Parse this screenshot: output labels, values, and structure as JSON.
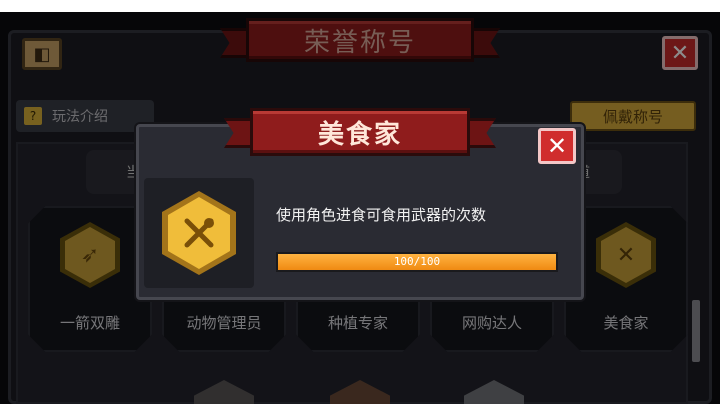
{
  "screen": {
    "title": "荣誉称号",
    "how_to_play": "玩法介绍",
    "how_to_icon": "?",
    "wear_title": "佩戴称号",
    "back_icon": "exit-icon",
    "close_icon": "close-icon",
    "category_left_fragment": "当",
    "category_right_fragment": "道",
    "titles": [
      {
        "label": "一箭双雕",
        "icon": "arrow-badge-icon"
      },
      {
        "label": "动物管理员",
        "icon": "animal-badge-icon"
      },
      {
        "label": "种植专家",
        "icon": "plant-badge-icon"
      },
      {
        "label": "网购达人",
        "icon": "shopping-badge-icon"
      },
      {
        "label": "美食家",
        "icon": "fork-spoon-badge-icon"
      }
    ]
  },
  "modal": {
    "title": "美食家",
    "description": "使用角色进食可食用武器的次数",
    "progress_text": "100/100",
    "progress_value": 1.0,
    "icon": "fork-spoon-badge-icon",
    "close_icon": "close-icon"
  },
  "colors": {
    "ribbon_red": "#8f1c1c",
    "gold": "#d6a93b",
    "progress_orange": "#f5a024",
    "close_red": "#d02d2d"
  }
}
